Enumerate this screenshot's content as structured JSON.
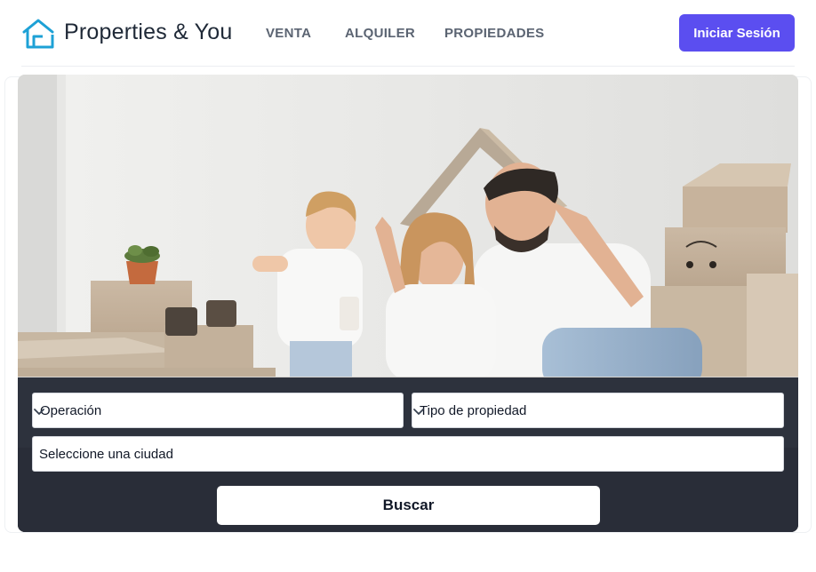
{
  "brand": {
    "name": "Properties & You",
    "logo_icon": "house-outline-icon",
    "accent": "#1da1d6"
  },
  "nav": {
    "items": [
      "VENTA",
      "ALQUILER",
      "PROPIEDADES"
    ]
  },
  "header": {
    "login_label": "Iniciar Sesión",
    "login_color": "#5b4ef0"
  },
  "hero": {
    "image": "family-with-moving-boxes-photo"
  },
  "search": {
    "operation": {
      "selected": "Operación",
      "icon": "chevron-down-icon"
    },
    "property_type": {
      "selected": "Tipo de propiedad",
      "icon": "chevron-down-icon"
    },
    "city": {
      "value": "Seleccione una ciudad"
    },
    "submit_label": "Buscar"
  }
}
